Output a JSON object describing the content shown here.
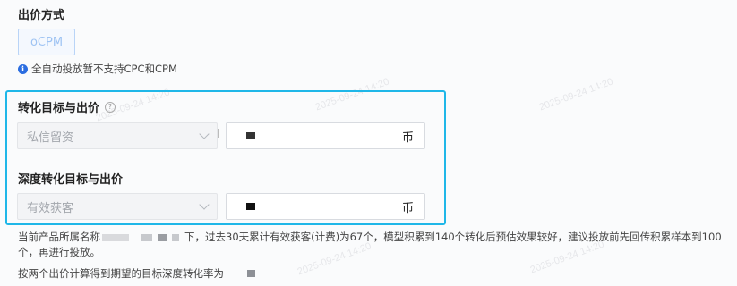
{
  "bid_method": {
    "title": "出价方式",
    "option": "oCPM",
    "notice": "全自动投放暂不支持CPC和CPM"
  },
  "conversion": {
    "label": "转化目标与出价",
    "select_value": "私信留资",
    "currency": "币"
  },
  "deep_conversion": {
    "label": "深度转化目标与出价",
    "select_value": "有效获客",
    "currency": "币"
  },
  "description": {
    "line1_prefix": "当前产品所属名称",
    "line1_main": "下，过去30天累计有效获客(计费)为67个，模型积累到140个转化后预估效果较好，建议投放前先回传积累样本到100个，再进行投放。",
    "line2": "按两个出价计算得到期望的目标深度转化率为"
  },
  "watermark": "2025-09-24 14:20",
  "icons": {
    "info": "info-icon",
    "help": "help-icon",
    "chevron": "chevron-down-icon"
  },
  "colors": {
    "highlight_border": "#1fb7e8",
    "info_blue": "#2b6de0",
    "ocpm_text": "#9ec3f3"
  }
}
